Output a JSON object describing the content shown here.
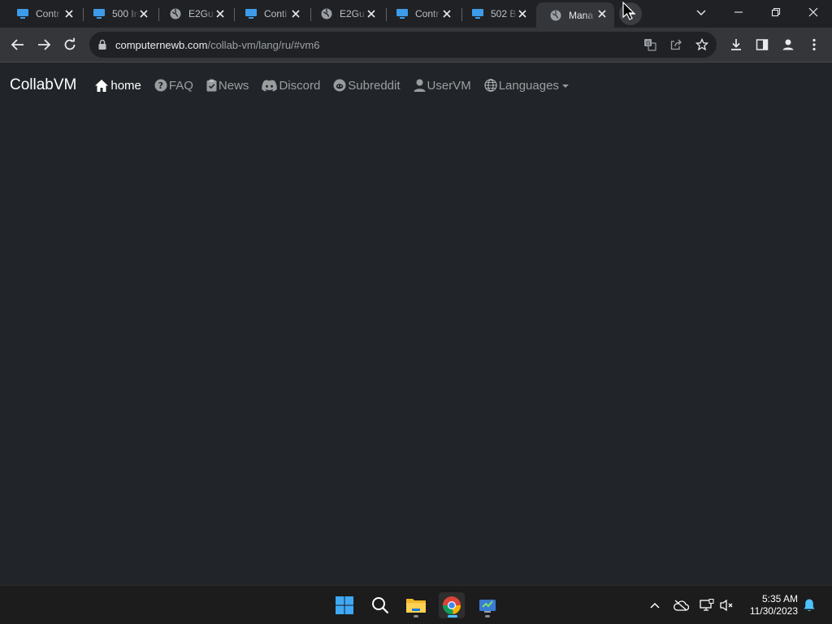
{
  "browser": {
    "tabs": [
      {
        "title": "Contr",
        "favicon": "monitor-icon"
      },
      {
        "title": "500 In",
        "favicon": "monitor-icon"
      },
      {
        "title": "E2Gu",
        "favicon": "globe-icon"
      },
      {
        "title": "Conti",
        "favicon": "monitor-icon"
      },
      {
        "title": "E2Gu",
        "favicon": "globe-icon"
      },
      {
        "title": "Contr",
        "favicon": "monitor-icon"
      },
      {
        "title": "502 B",
        "favicon": "monitor-icon"
      },
      {
        "title": "Mana",
        "favicon": "globe-icon",
        "active": true
      }
    ],
    "address": {
      "host": "computernewb.com",
      "path": "/collab-vm/lang/ru/#vm6"
    }
  },
  "site": {
    "brand": "CollabVM",
    "nav": [
      {
        "label": "home",
        "icon": "home-icon",
        "active": true
      },
      {
        "label": "FAQ",
        "icon": "question-circle-icon"
      },
      {
        "label": "News",
        "icon": "clipboard-check-icon"
      },
      {
        "label": "Discord",
        "icon": "discord-icon"
      },
      {
        "label": "Subreddit",
        "icon": "reddit-icon"
      },
      {
        "label": "UserVM",
        "icon": "person-icon"
      },
      {
        "label": "Languages",
        "icon": "globe-icon",
        "dropdown": true
      }
    ]
  },
  "taskbar": {
    "apps": [
      "start-icon",
      "search-icon",
      "file-explorer-icon",
      "chrome-icon",
      "vm-app-icon"
    ],
    "clock": {
      "time": "5:35 AM",
      "date": "11/30/2023"
    }
  },
  "colors": {
    "page_bg": "#212529",
    "chrome_bg": "#202124",
    "toolbar_bg": "#35363a",
    "taskbar_bg": "#1c1c1c",
    "accent": "#4cc2ff"
  }
}
